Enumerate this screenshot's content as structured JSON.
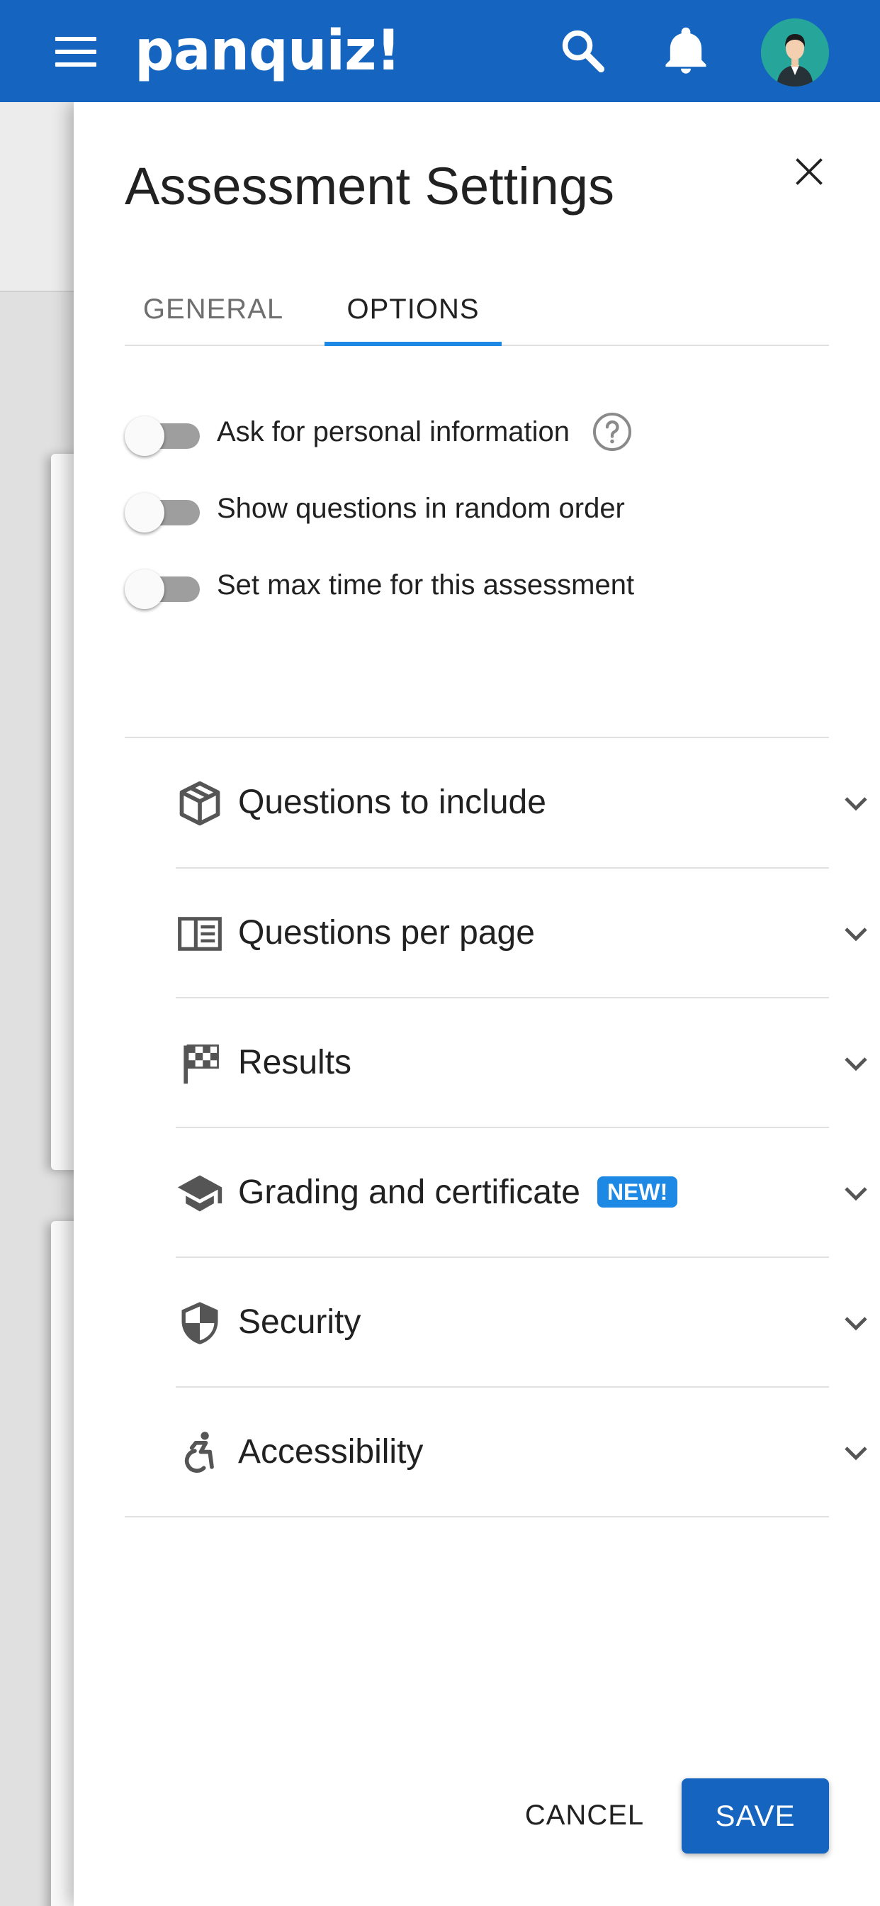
{
  "appbar": {
    "logo": "panquiz!",
    "menu_icon": "hamburger-menu-icon",
    "search_icon": "search-icon",
    "notifications_icon": "bell-icon",
    "avatar_icon": "user-avatar",
    "brand_color": "#1565c0"
  },
  "drawer": {
    "title": "Assessment Settings",
    "close_icon": "close-icon",
    "tabs": [
      {
        "label": "GENERAL",
        "active": false
      },
      {
        "label": "OPTIONS",
        "active": true
      }
    ],
    "tab_indicator_color": "#1e88e5",
    "switches": [
      {
        "label": "Ask for personal information",
        "on": false,
        "has_help": true
      },
      {
        "label": "Show questions in random order",
        "on": false
      },
      {
        "label": "Set max time for this assessment",
        "on": false
      }
    ],
    "sections": [
      {
        "label": "Questions to include",
        "icon": "cube-icon"
      },
      {
        "label": "Questions per page",
        "icon": "page-layout-icon"
      },
      {
        "label": "Results",
        "icon": "checkered-flag-icon"
      },
      {
        "label": "Grading and certificate",
        "icon": "graduation-cap-icon",
        "badge": "NEW!"
      },
      {
        "label": "Security",
        "icon": "shield-icon"
      },
      {
        "label": "Accessibility",
        "icon": "accessibility-icon"
      }
    ],
    "cancel_label": "CANCEL",
    "save_label": "SAVE"
  }
}
